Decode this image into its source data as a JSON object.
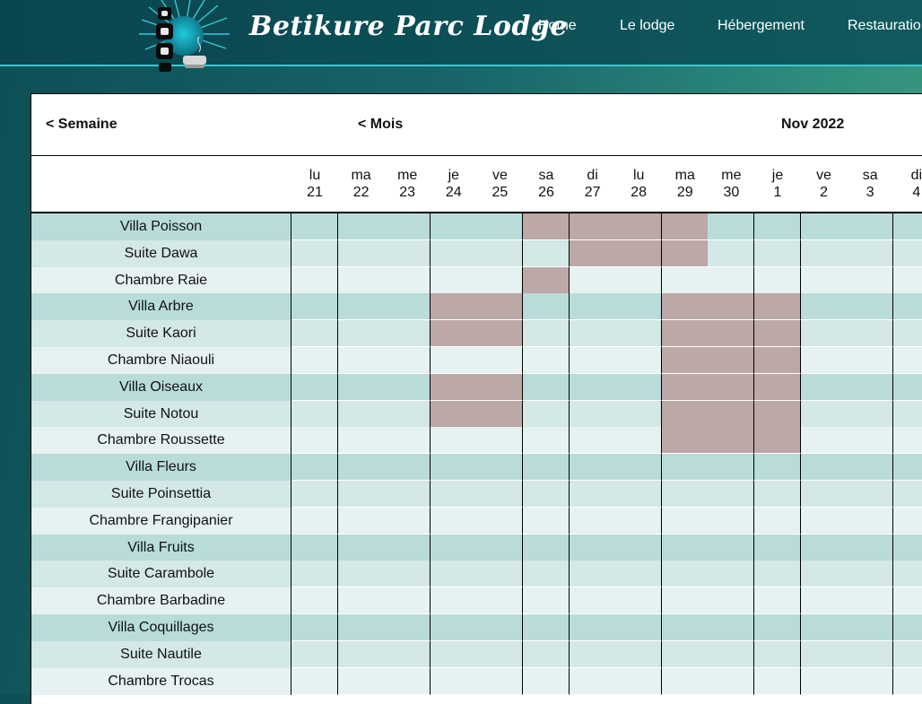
{
  "header": {
    "brand": "Betikure Parc Lodge",
    "logo_icon": "lodge-logo-icon",
    "nav": [
      "Home",
      "Le lodge",
      "Hébergement",
      "Restauration"
    ]
  },
  "toolbar": {
    "prev_week": "< Semaine",
    "prev_month": "< Mois",
    "month_label": "Nov 2022"
  },
  "days": [
    {
      "dow": "lu",
      "date": "21"
    },
    {
      "dow": "ma",
      "date": "22"
    },
    {
      "dow": "me",
      "date": "23"
    },
    {
      "dow": "je",
      "date": "24"
    },
    {
      "dow": "ve",
      "date": "25"
    },
    {
      "dow": "sa",
      "date": "26"
    },
    {
      "dow": "di",
      "date": "27"
    },
    {
      "dow": "lu",
      "date": "28"
    },
    {
      "dow": "ma",
      "date": "29"
    },
    {
      "dow": "me",
      "date": "30"
    },
    {
      "dow": "je",
      "date": "1"
    },
    {
      "dow": "ve",
      "date": "2"
    },
    {
      "dow": "sa",
      "date": "3"
    },
    {
      "dow": "di",
      "date": "4"
    }
  ],
  "rooms": [
    {
      "name": "Villa Poisson",
      "booked": [
        5,
        6,
        7,
        8
      ]
    },
    {
      "name": "Suite Dawa",
      "booked": [
        6,
        7,
        8
      ]
    },
    {
      "name": "Chambre Raie",
      "booked": [
        5
      ]
    },
    {
      "name": "Villa Arbre",
      "booked": [
        3,
        4,
        8,
        9,
        10
      ]
    },
    {
      "name": "Suite Kaori",
      "booked": [
        3,
        4,
        8,
        9,
        10
      ]
    },
    {
      "name": "Chambre Niaouli",
      "booked": [
        8,
        9,
        10
      ]
    },
    {
      "name": "Villa Oiseaux",
      "booked": [
        3,
        4,
        8,
        9,
        10
      ]
    },
    {
      "name": "Suite Notou",
      "booked": [
        3,
        4,
        8,
        9,
        10
      ]
    },
    {
      "name": "Chambre Roussette",
      "booked": [
        8,
        9,
        10
      ]
    },
    {
      "name": "Villa Fleurs",
      "booked": []
    },
    {
      "name": "Suite Poinsettia",
      "booked": []
    },
    {
      "name": "Chambre Frangipanier",
      "booked": []
    },
    {
      "name": "Villa Fruits",
      "booked": []
    },
    {
      "name": "Suite Carambole",
      "booked": []
    },
    {
      "name": "Chambre Barbadine",
      "booked": []
    },
    {
      "name": "Villa Coquillages",
      "booked": []
    },
    {
      "name": "Suite Nautile",
      "booked": []
    },
    {
      "name": "Chambre Trocas",
      "booked": []
    }
  ],
  "colors": {
    "booked": "#bca8a7",
    "villa_row": "#b9dcdb",
    "suite_row": "#d3e8e7",
    "chambre_row": "#e5f2f1",
    "accent_line": "#3ec7d2"
  }
}
